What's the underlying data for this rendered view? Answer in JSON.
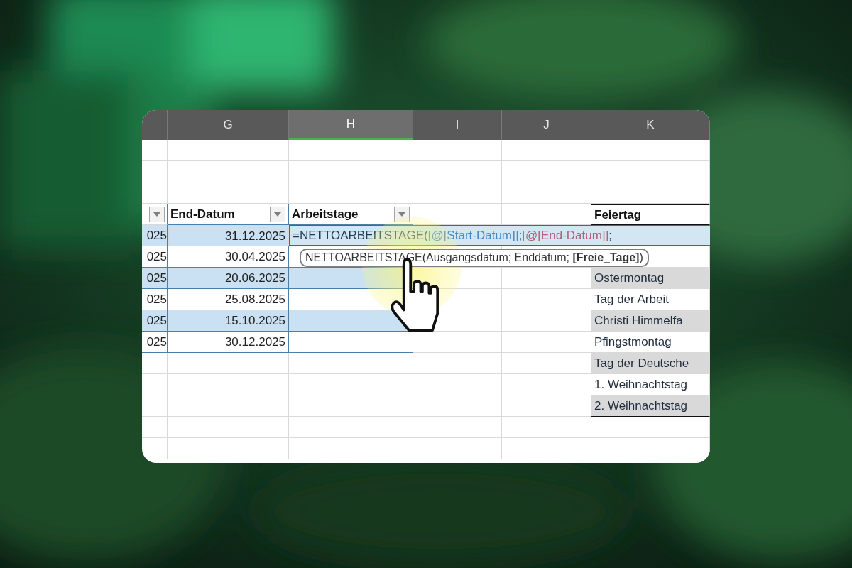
{
  "columns": [
    {
      "label": "G",
      "selected": false
    },
    {
      "label": "H",
      "selected": true
    },
    {
      "label": "I",
      "selected": false
    },
    {
      "label": "J",
      "selected": false
    },
    {
      "label": "K",
      "selected": false
    }
  ],
  "table": {
    "headers": [
      {
        "label": "End-Datum"
      },
      {
        "label": "Arbeitstage"
      }
    ],
    "rows": [
      {
        "start": "025",
        "end": "31.12.2025",
        "referenced": true
      },
      {
        "start": "025",
        "end": "30.04.2025",
        "referenced": false
      },
      {
        "start": "025",
        "end": "20.06.2025",
        "referenced": false
      },
      {
        "start": "025",
        "end": "25.08.2025",
        "referenced": false
      },
      {
        "start": "025",
        "end": "15.10.2025",
        "referenced": false
      },
      {
        "start": "025",
        "end": "30.12.2025",
        "referenced": false
      }
    ]
  },
  "formula": {
    "segments": [
      {
        "text": "=NETTOARBEITSTAGE("
      },
      {
        "text": "[@[Start-Datum]]",
        "color": "#4a86c5"
      },
      {
        "text": ";"
      },
      {
        "text": "[@[End-Datum]]",
        "color": "#b0607a"
      },
      {
        "text": ";"
      }
    ]
  },
  "tooltip": "NETTOARBEITSTAGE(Ausgangsdatum; Enddatum; **[Freie_Tage]**)",
  "holidays": {
    "header": "Feiertag",
    "items": [
      "Ostermontag",
      "Tag der Arbeit",
      "Christi Himmelfa",
      "Pfingstmontag",
      "Tag der Deutsche",
      "1. Weihnachtstag",
      "2. Weihnachtstag"
    ]
  }
}
